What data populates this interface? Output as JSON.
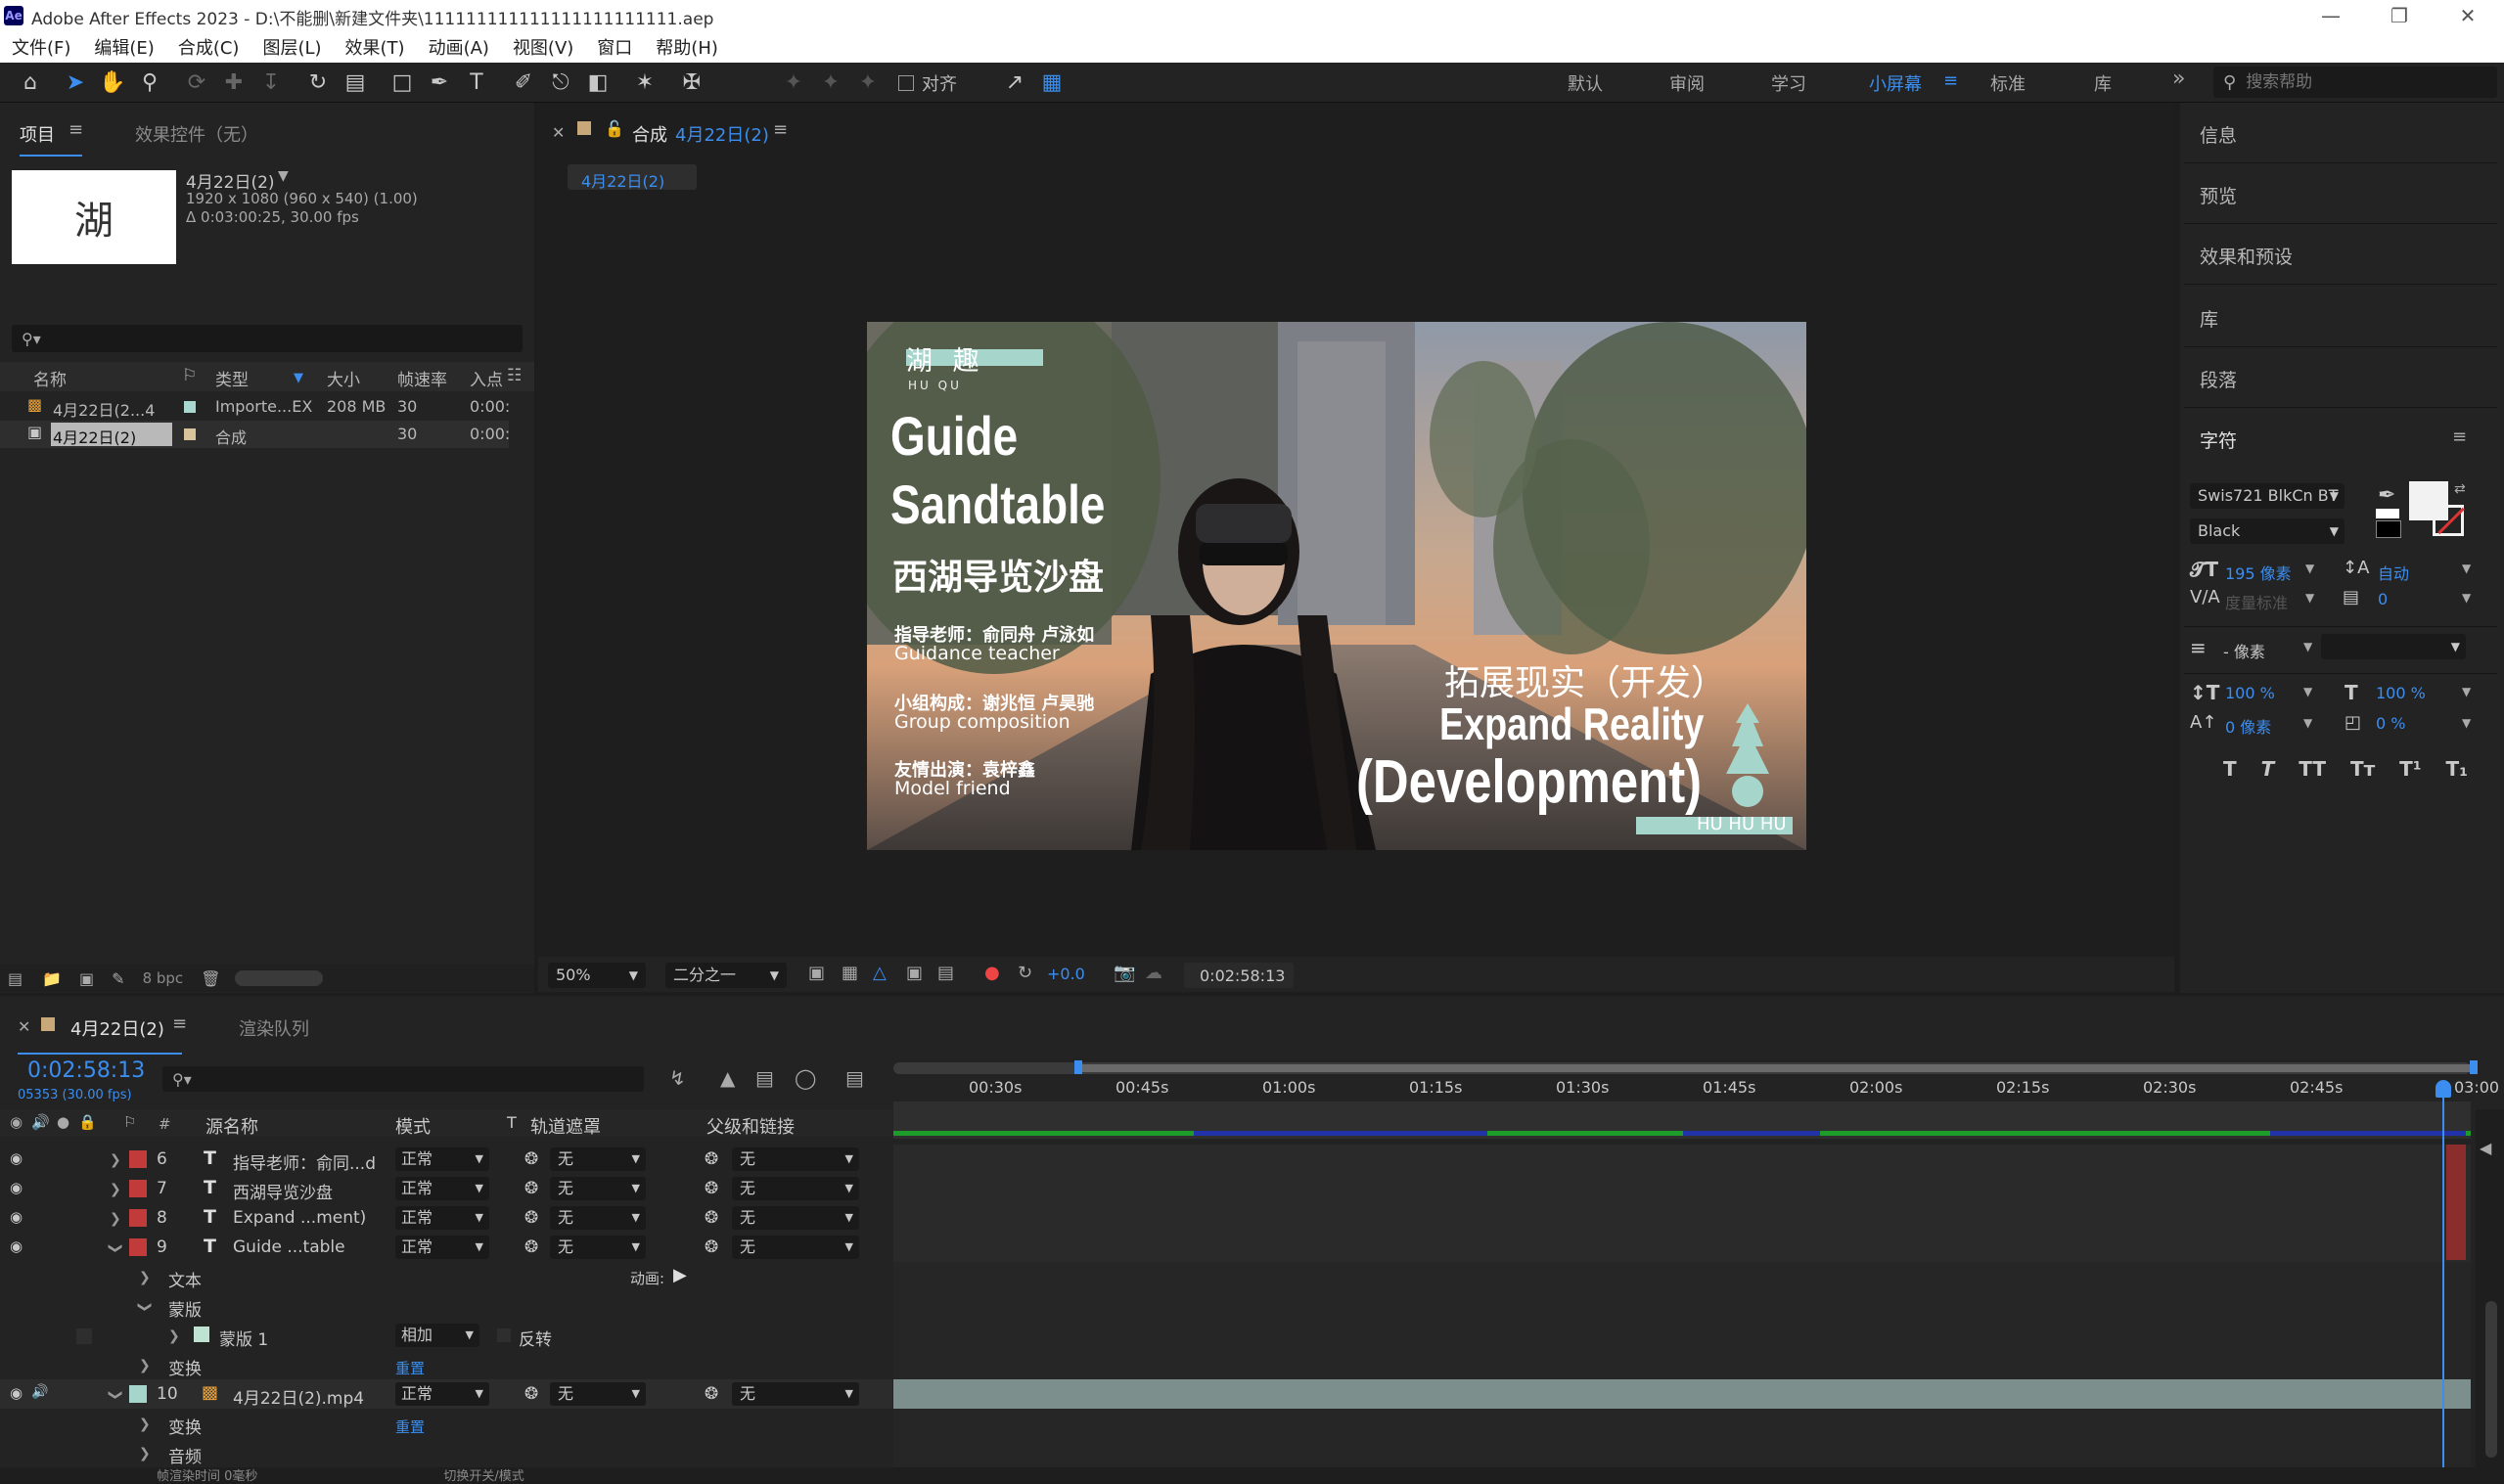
{
  "app": {
    "title": "Adobe After Effects 2023 - D:\\不能删\\新建文件夹\\111111111111111111111111.aep",
    "logo": "Ae",
    "menu": [
      "文件(F)",
      "编辑(E)",
      "合成(C)",
      "图层(L)",
      "效果(T)",
      "动画(A)",
      "视图(V)",
      "窗口",
      "帮助(H)"
    ]
  },
  "toolbar": {
    "align_label": "对齐",
    "workspaces": [
      "默认",
      "审阅",
      "学习",
      "小屏幕",
      "标准",
      "库"
    ],
    "active_workspace": "小屏幕",
    "more": "»",
    "help_placeholder": "搜索帮助"
  },
  "project": {
    "tab_project": "项目",
    "tab_effects": "效果控件（无）",
    "comp_name": "4月22日(2)",
    "comp_info_1": "1920 x 1080  (960 x 540) (1.00)",
    "comp_info_2": "Δ 0:03:00:25, 30.00 fps",
    "thumb_char": "湖",
    "columns": [
      "名称",
      "类型",
      "大小",
      "帧速率",
      "入点"
    ],
    "rows": [
      {
        "name": "4月22日(2...4",
        "type": "Importe...EX",
        "size": "208 MB",
        "fps": "30",
        "in": "0:00:"
      },
      {
        "name": "4月22日(2)",
        "type": "合成",
        "size": "",
        "fps": "30",
        "in": "0:00:"
      }
    ],
    "bpc": "8 bpc"
  },
  "comp": {
    "tab_prefix": "合成",
    "tab_name": "4月22日(2)",
    "breadcrumb": "4月22日(2)",
    "zoom": "50%",
    "resolution": "二分之一",
    "exposure": "+0.0",
    "timecode": "0:02:58:13",
    "frame": {
      "top_tag": "湖 趣",
      "top_sub": "HU  QU",
      "title1": "Guide",
      "title2": "Sandtable",
      "title_cn": "西湖导览沙盘",
      "credit1_cn": "指导老师：俞同舟 卢泳如",
      "credit1_en": "Guidance teacher",
      "credit2_cn": "小组构成：谢兆恒 卢昊驰",
      "credit2_en": "Group composition",
      "credit3_cn": "友情出演：袁梓鑫",
      "credit3_en": "Model friend",
      "right_cn": "拓展现实（开发）",
      "right_en1": "Expand Reality",
      "right_en2": "(Development)",
      "bottom_tag": "HU HU HU"
    }
  },
  "right": {
    "panels": [
      "信息",
      "预览",
      "效果和预设",
      "库",
      "段落",
      "字符"
    ],
    "font_family": "Swis721 BlkCn BT",
    "font_style": "Black",
    "font_size": "195 像素",
    "leading": "自动",
    "kerning": "度量标准",
    "tracking": "0",
    "stroke": "- 像素",
    "vscale": "100 %",
    "hscale": "100 %",
    "baseline": "0 像素",
    "tsume": "0 %",
    "type_buttons": [
      "T",
      "T",
      "TT",
      "Tт",
      "T¹",
      "T₁"
    ],
    "colors": {
      "fill": "#f2f2f2",
      "accent": "#3b8ef0"
    }
  },
  "timeline": {
    "tab_name": "4月22日(2)",
    "render_queue": "渲染队列",
    "timecode": "0:02:58:13",
    "frame_info": "05353 (30.00 fps)",
    "columns": [
      "源名称",
      "模式",
      "T",
      "轨道遮罩",
      "父级和链接"
    ],
    "ruler": [
      "00:30s",
      "00:45s",
      "01:00s",
      "01:15s",
      "01:30s",
      "01:45s",
      "02:00s",
      "02:15s",
      "02:30s",
      "02:45s",
      "03:00"
    ],
    "layers": [
      {
        "num": "6",
        "name": "指导老师：俞同...d",
        "mode": "正常",
        "matte": "无",
        "parent": "无"
      },
      {
        "num": "7",
        "name": "西湖导览沙盘",
        "mode": "正常",
        "matte": "无",
        "parent": "无"
      },
      {
        "num": "8",
        "name": "Expand ...ment)",
        "mode": "正常",
        "matte": "无",
        "parent": "无"
      },
      {
        "num": "9",
        "name": "Guide  ...table",
        "mode": "正常",
        "matte": "无",
        "parent": "无"
      }
    ],
    "sub_text": "文本",
    "animate": "动画:",
    "sub_mask": "蒙版",
    "mask_name": "蒙版 1",
    "mask_mode": "相加",
    "mask_invert": "反转",
    "sub_transform": "变换",
    "reset": "重置",
    "video_layer": {
      "num": "10",
      "name": "4月22日(2).mp4",
      "mode": "正常",
      "matte": "无",
      "parent": "无"
    },
    "sub_transform2": "变换",
    "reset2": "重置",
    "sub_audio": "音频",
    "footer_left": "帧渲染时间  0毫秒",
    "footer_mid": "切换开关/模式"
  }
}
